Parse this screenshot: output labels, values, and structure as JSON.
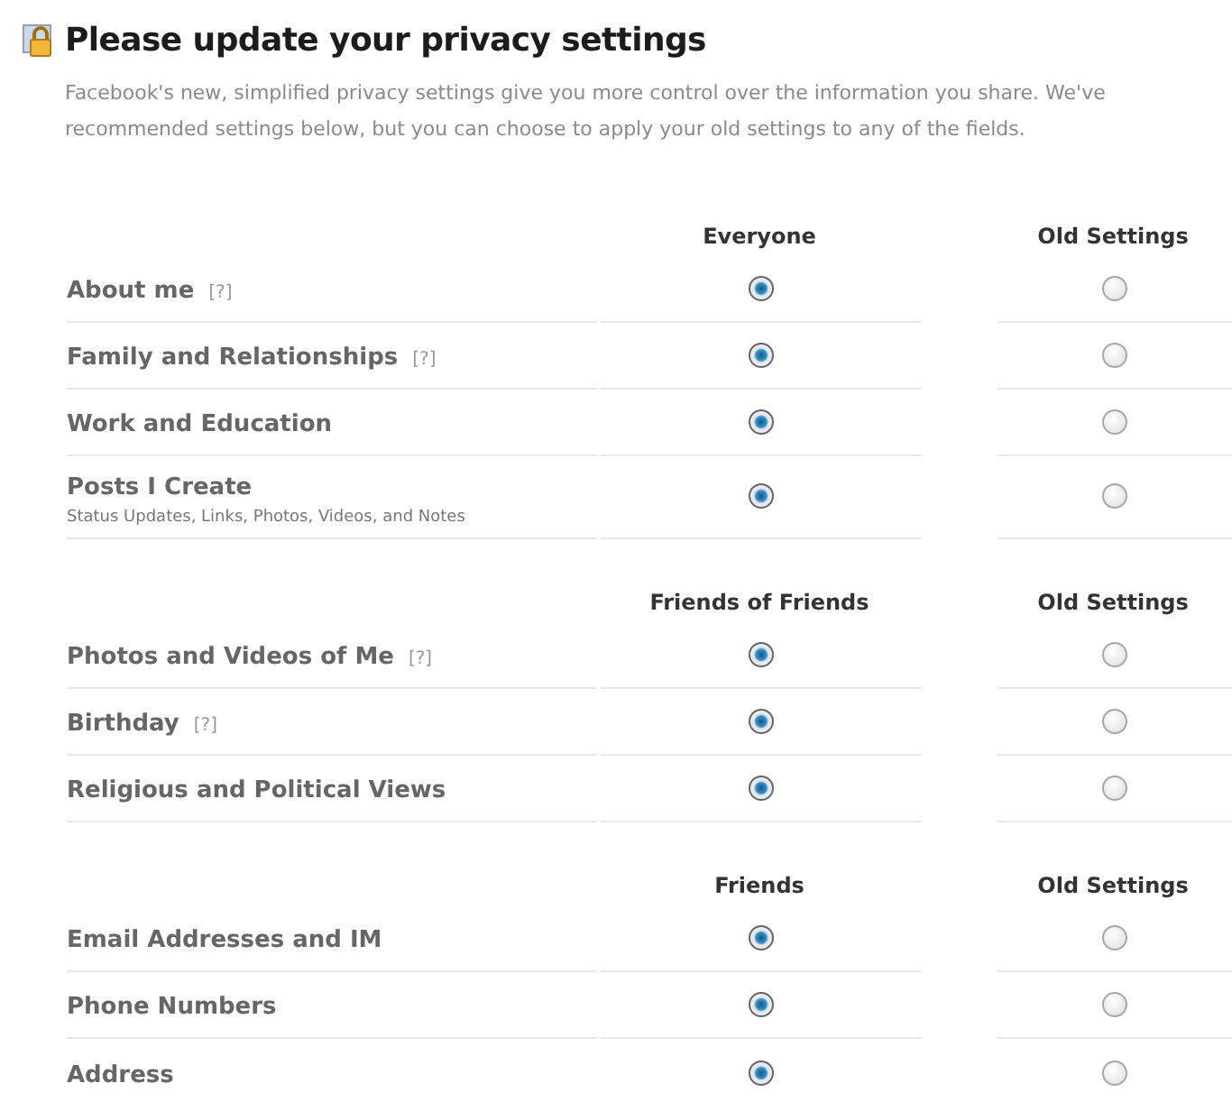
{
  "title": "Please update your privacy settings",
  "description": "Facebook's new, simplified privacy settings give you more control over the information you share. We've recommended settings below, but you can choose to apply your old settings to any of the fields.",
  "groups": [
    {
      "columns": [
        "Everyone",
        "Old Settings"
      ],
      "rows": [
        {
          "label": "About me",
          "help": "[?]",
          "options": [
            {
              "selected": true
            },
            {
              "selected": false
            }
          ]
        },
        {
          "label": "Family and Relationships",
          "help": "[?]",
          "options": [
            {
              "selected": true
            },
            {
              "selected": false
            }
          ]
        },
        {
          "label": "Work and Education",
          "options": [
            {
              "selected": true
            },
            {
              "selected": false
            }
          ]
        },
        {
          "label": "Posts I Create",
          "sublabel": "Status Updates, Links, Photos, Videos, and Notes",
          "options": [
            {
              "selected": true
            },
            {
              "selected": false
            }
          ]
        }
      ]
    },
    {
      "columns": [
        "Friends of Friends",
        "Old Settings"
      ],
      "rows": [
        {
          "label": "Photos and Videos of Me",
          "help": "[?]",
          "options": [
            {
              "selected": true
            },
            {
              "selected": false
            }
          ]
        },
        {
          "label": "Birthday",
          "help": "[?]",
          "options": [
            {
              "selected": true
            },
            {
              "selected": false
            }
          ]
        },
        {
          "label": "Religious and Political Views",
          "options": [
            {
              "selected": true
            },
            {
              "selected": false
            }
          ]
        }
      ]
    },
    {
      "columns": [
        "Friends",
        "Old Settings"
      ],
      "rows": [
        {
          "label": "Email Addresses and IM",
          "options": [
            {
              "selected": true
            },
            {
              "selected": false
            }
          ]
        },
        {
          "label": "Phone Numbers",
          "options": [
            {
              "selected": true
            },
            {
              "selected": false
            }
          ]
        },
        {
          "label": "Address",
          "options": [
            {
              "selected": true
            },
            {
              "selected": false
            }
          ]
        }
      ]
    }
  ]
}
